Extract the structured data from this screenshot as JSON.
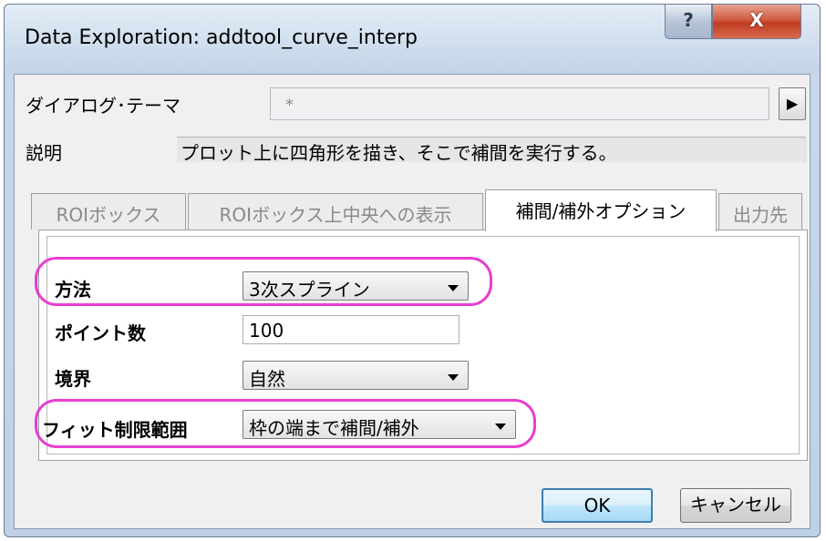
{
  "window": {
    "title": "Data Exploration: addtool_curve_interp",
    "help_glyph": "?",
    "close_glyph": "X"
  },
  "theme": {
    "label": "ダイアログ･テーマ",
    "value": "*",
    "arrow_glyph": "▶"
  },
  "description": {
    "label": "説明",
    "text": "プロット上に四角形を描き、そこで補間を実行する。"
  },
  "tabs": [
    {
      "label": "ROIボックス",
      "active": false
    },
    {
      "label": "ROIボックス上中央への表示",
      "active": false
    },
    {
      "label": "補間/補外オプション",
      "active": true
    },
    {
      "label": "出力先",
      "active": false
    }
  ],
  "fields": {
    "method": {
      "label": "方法",
      "value": "3次スプライン"
    },
    "points": {
      "label": "ポイント数",
      "value": "100"
    },
    "boundary": {
      "label": "境界",
      "value": "自然"
    },
    "fit_limit": {
      "label": "フィット制限範囲",
      "value": "枠の端まで補間/補外"
    }
  },
  "buttons": {
    "ok": "OK",
    "cancel": "キャンセル"
  },
  "colors": {
    "highlight": "#e83fd0",
    "titlebar": "#cfdded",
    "close_button": "#c03c22"
  }
}
